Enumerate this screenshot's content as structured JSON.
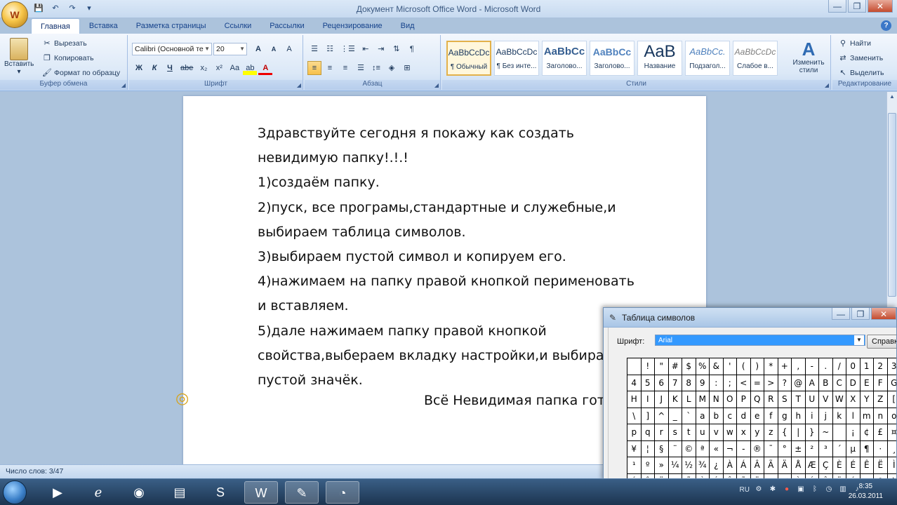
{
  "window": {
    "title": "Документ Microsoft Office Word - Microsoft Word",
    "office_button_label": "W",
    "controls": {
      "minimize": "—",
      "maximize": "❐",
      "close": "✕"
    }
  },
  "quick_access": {
    "save": "💾",
    "undo": "↶",
    "redo": "↷",
    "customize": "▾"
  },
  "tabs": [
    {
      "label": "Главная",
      "active": true
    },
    {
      "label": "Вставка"
    },
    {
      "label": "Разметка страницы"
    },
    {
      "label": "Ссылки"
    },
    {
      "label": "Рассылки"
    },
    {
      "label": "Рецензирование"
    },
    {
      "label": "Вид"
    }
  ],
  "help_icon": "?",
  "ribbon": {
    "clipboard": {
      "label": "Буфер обмена",
      "paste": "Вставить",
      "cut": "Вырезать",
      "copy": "Копировать",
      "format_painter": "Формат по образцу"
    },
    "font": {
      "label": "Шрифт",
      "font_name": "Calibri (Основной те",
      "font_size": "20",
      "grow": "A",
      "shrink": "A",
      "clear": "A",
      "bold": "Ж",
      "italic": "К",
      "underline": "Ч",
      "strike": "abe",
      "subscript": "x₂",
      "superscript": "x²",
      "case": "Aa",
      "highlight": "ab",
      "font_color": "A"
    },
    "paragraph": {
      "label": "Абзац",
      "show_marks": "¶"
    },
    "styles": {
      "label": "Стили",
      "items": [
        {
          "preview": "AaBbCcDc",
          "name": "¶ Обычный",
          "selected": true
        },
        {
          "preview": "AaBbCcDc",
          "name": "¶ Без инте..."
        },
        {
          "preview": "AaBbCc",
          "name": "Заголово..."
        },
        {
          "preview": "AaBbCc",
          "name": "Заголово..."
        },
        {
          "preview": "AaB",
          "name": "Название"
        },
        {
          "preview": "AaBbCc.",
          "name": "Подзагол..."
        },
        {
          "preview": "AaBbCcDc",
          "name": "Слабое в..."
        }
      ],
      "change_styles": "Изменить стили"
    },
    "editing": {
      "label": "Редактирование",
      "find": "Найти",
      "replace": "Заменить",
      "select": "Выделить"
    }
  },
  "document": {
    "lines": [
      "Здравствуйте сегодня я покажу как создать",
      "невидимую папку!.!.!",
      "1)создаём папку.",
      "2)пуск, все програмы,стандартные и служебные,и",
      "выбираем таблица символов.",
      "3)выбираем пустой символ и копируем его.",
      "4)нажимаем на папку правой кнопкой перименовать",
      "и вставляем.",
      "5)дале нажимаем папку правой кнопкой",
      "свойства,выбераем вкладку настройки,и выбираем",
      "пустой значёк."
    ],
    "final_line": "Всё Невидимая папка готова"
  },
  "statusbar": {
    "word_count": "Число слов: 3/47"
  },
  "charmap": {
    "title": "Таблица символов",
    "font_label": "Шрифт:",
    "font_value": "Arial",
    "help_button": "Справка",
    "rows": [
      [
        " ",
        "!",
        "\"",
        "#",
        "$",
        "%",
        "&",
        "'",
        "(",
        ")",
        "*",
        "+",
        ",",
        "-",
        ".",
        "/",
        "0",
        "1",
        "2",
        "3"
      ],
      [
        "4",
        "5",
        "6",
        "7",
        "8",
        "9",
        ":",
        ";",
        "<",
        "=",
        ">",
        "?",
        "@",
        "A",
        "B",
        "C",
        "D",
        "E",
        "F",
        "G"
      ],
      [
        "H",
        "I",
        "J",
        "K",
        "L",
        "M",
        "N",
        "O",
        "P",
        "Q",
        "R",
        "S",
        "T",
        "U",
        "V",
        "W",
        "X",
        "Y",
        "Z",
        "["
      ],
      [
        "\\",
        "]",
        "^",
        "_",
        "`",
        "a",
        "b",
        "c",
        "d",
        "e",
        "f",
        "g",
        "h",
        "i",
        "j",
        "k",
        "l",
        "m",
        "n",
        "o"
      ],
      [
        "p",
        "q",
        "r",
        "s",
        "t",
        "u",
        "v",
        "w",
        "x",
        "y",
        "z",
        "{",
        "|",
        "}",
        "~",
        " ",
        "¡",
        "¢",
        "£",
        "¤"
      ],
      [
        "¥",
        "¦",
        "§",
        "¨",
        "©",
        "ª",
        "«",
        "¬",
        "-",
        "®",
        "¯",
        "°",
        "±",
        "²",
        "³",
        "´",
        "µ",
        "¶",
        "·",
        "¸"
      ],
      [
        "¹",
        "º",
        "»",
        "¼",
        "½",
        "¾",
        "¿",
        "À",
        "Á",
        "Â",
        "Ã",
        "Ä",
        "Å",
        "Æ",
        "Ç",
        "È",
        "É",
        "Ê",
        "Ë",
        "Ì"
      ],
      [
        "Í",
        "Î",
        "Ï",
        "Ð",
        "Ñ",
        "Ò",
        "Ó",
        "Ô",
        "Õ",
        "Ö",
        "×",
        "Ø",
        "Ù",
        "Ú",
        "Û",
        "Ü",
        "Ý",
        "Þ",
        "ß",
        "à"
      ]
    ]
  },
  "taskbar": {
    "language": "RU",
    "time": "8:35",
    "date": "26.03.2011"
  }
}
